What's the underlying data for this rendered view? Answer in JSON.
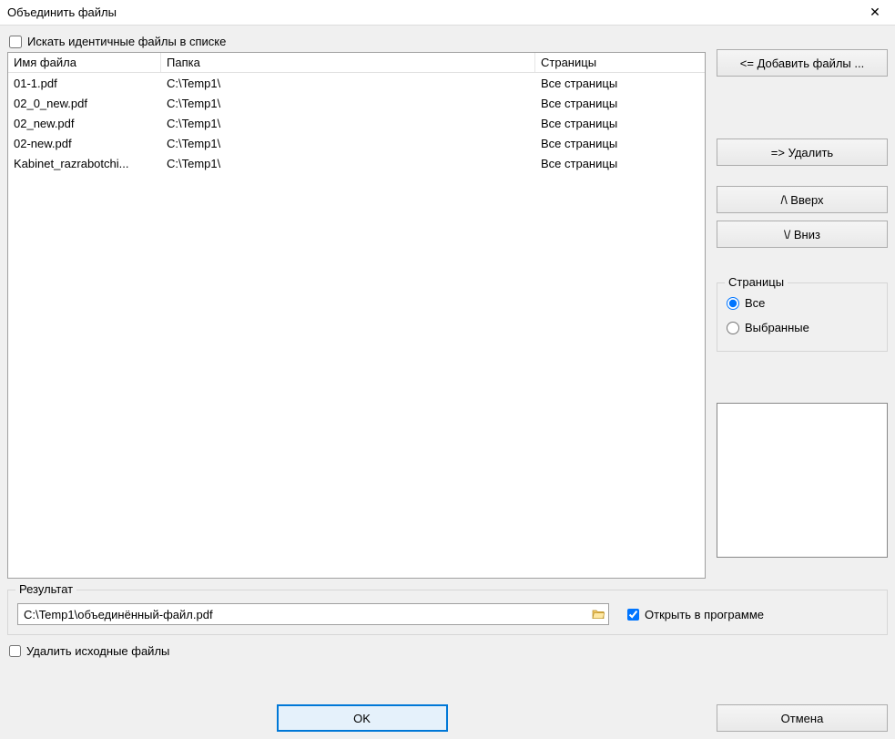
{
  "window": {
    "title": "Объединить файлы"
  },
  "options": {
    "search_identical_label": "Искать идентичные файлы в списке",
    "delete_source_label": "Удалить исходные файлы",
    "open_in_program_label": "Открыть в программе"
  },
  "table": {
    "headers": {
      "name": "Имя файла",
      "folder": "Папка",
      "pages": "Страницы"
    },
    "rows": [
      {
        "name": "01-1.pdf",
        "folder": "C:\\Temp1\\",
        "pages": "Все страницы"
      },
      {
        "name": "02_0_new.pdf",
        "folder": "C:\\Temp1\\",
        "pages": "Все страницы"
      },
      {
        "name": "02_new.pdf",
        "folder": "C:\\Temp1\\",
        "pages": "Все страницы"
      },
      {
        "name": "02-new.pdf",
        "folder": "C:\\Temp1\\",
        "pages": "Все страницы"
      },
      {
        "name": "Kabinet_razrabotchi...",
        "folder": "C:\\Temp1\\",
        "pages": "Все страницы"
      }
    ]
  },
  "side_buttons": {
    "add": "<=  Добавить файлы ...",
    "remove": "=>  Удалить",
    "up": "/\\   Вверх",
    "down": "\\/   Вниз"
  },
  "pages_group": {
    "legend": "Страницы",
    "all": "Все",
    "selected": "Выбранные"
  },
  "result": {
    "legend": "Результат",
    "path": "C:\\Temp1\\объединённый-файл.pdf"
  },
  "footer": {
    "ok": "OK",
    "cancel": "Отмена"
  }
}
